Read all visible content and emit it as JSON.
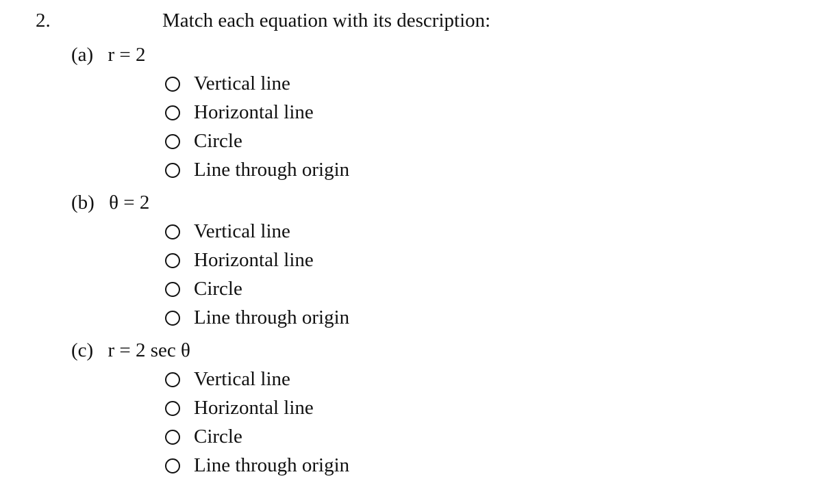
{
  "question": {
    "number": "2.",
    "prompt": "Match each equation with its description:"
  },
  "parts": [
    {
      "label": "(a)",
      "equation": "r = 2",
      "options": [
        "Vertical line",
        "Horizontal line",
        "Circle",
        "Line through origin"
      ],
      "selected": null
    },
    {
      "label": "(b)",
      "equation": "θ = 2",
      "options": [
        "Vertical line",
        "Horizontal line",
        "Circle",
        "Line through origin"
      ],
      "selected": null
    },
    {
      "label": "(c)",
      "equation": "r = 2 sec θ",
      "options": [
        "Vertical line",
        "Horizontal line",
        "Circle",
        "Line through origin"
      ],
      "selected": null
    }
  ]
}
